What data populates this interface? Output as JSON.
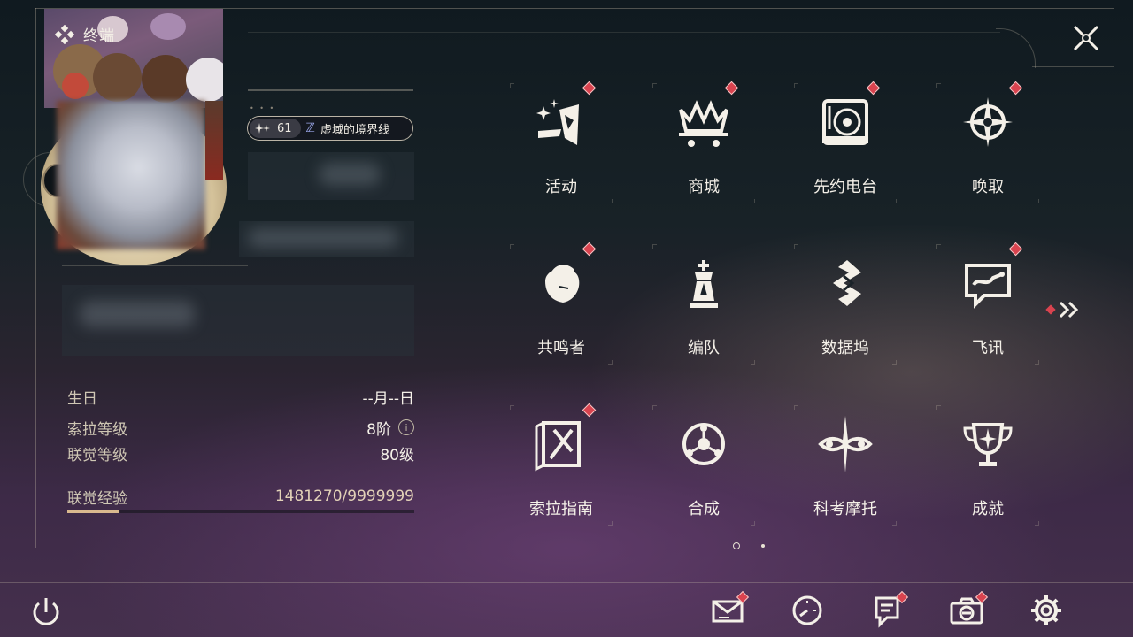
{
  "header": {
    "title": "终端"
  },
  "profile": {
    "level_number": "61",
    "realm_name": "虚域的境界线"
  },
  "stats": [
    {
      "label": "生日",
      "value": "--月--日"
    },
    {
      "label": "索拉等级",
      "value": "8阶"
    },
    {
      "label": "联觉等级",
      "value": "80级"
    },
    {
      "label": "联觉经验",
      "value": "1481270/9999999"
    }
  ],
  "experience": {
    "current": 1481270,
    "max": 9999999
  },
  "menu": {
    "items": [
      {
        "label": "活动",
        "icon": "activity-icon",
        "badge": true
      },
      {
        "label": "商城",
        "icon": "shop-crown-cart-icon",
        "badge": true
      },
      {
        "label": "先约电台",
        "icon": "radio-turntable-icon",
        "badge": true
      },
      {
        "label": "唤取",
        "icon": "compass-star-icon",
        "badge": true
      },
      {
        "label": "共鸣者",
        "icon": "character-portrait-icon",
        "badge": true
      },
      {
        "label": "编队",
        "icon": "chess-team-icon",
        "badge": false
      },
      {
        "label": "数据坞",
        "icon": "data-dock-icon",
        "badge": false
      },
      {
        "label": "飞讯",
        "icon": "chat-message-icon",
        "badge": true
      },
      {
        "label": "索拉指南",
        "icon": "guide-book-icon",
        "badge": true
      },
      {
        "label": "合成",
        "icon": "synthesis-icon",
        "badge": false
      },
      {
        "label": "科考摩托",
        "icon": "motorbike-icon",
        "badge": false
      },
      {
        "label": "成就",
        "icon": "trophy-icon",
        "badge": false
      }
    ],
    "page": 1,
    "page_count": 2
  },
  "bottom_bar": [
    {
      "name": "mail",
      "icon": "mail-icon",
      "badge": true
    },
    {
      "name": "clock",
      "icon": "clock-icon",
      "badge": false
    },
    {
      "name": "notice",
      "icon": "notice-icon",
      "badge": true
    },
    {
      "name": "camera",
      "icon": "camera-icon",
      "badge": true
    },
    {
      "name": "settings",
      "icon": "gear-icon",
      "badge": false
    }
  ],
  "colors": {
    "badge": "#d9434f",
    "text": "#f4f0e8",
    "label": "#cfc7b4",
    "exp_fill": "#d9b98e",
    "realm_icon": "#9aa6e8"
  }
}
